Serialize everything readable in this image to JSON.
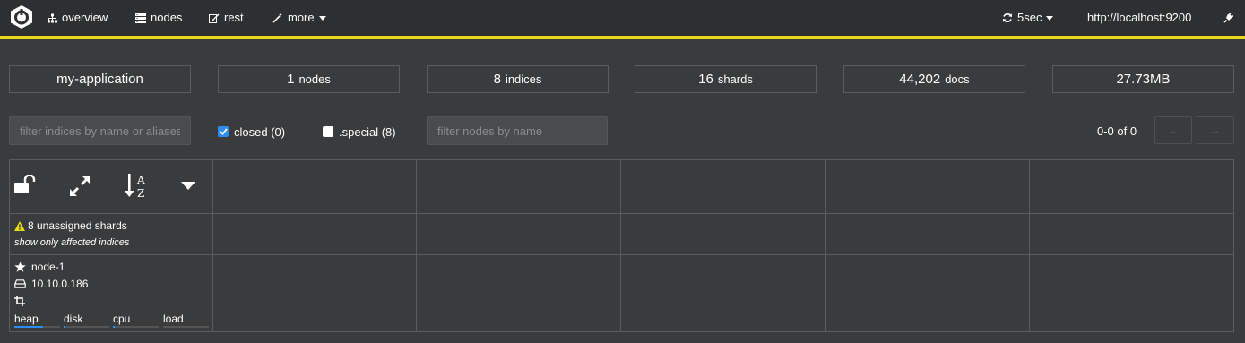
{
  "nav": {
    "items": [
      {
        "label": "overview",
        "icon": "sitemap-icon"
      },
      {
        "label": "nodes",
        "icon": "server-icon"
      },
      {
        "label": "rest",
        "icon": "edit-icon"
      },
      {
        "label": "more",
        "icon": "magic-wand-icon"
      }
    ],
    "refresh_label": "5sec",
    "host": "http://localhost:9200",
    "accent_color": "#e8d91a"
  },
  "stats": {
    "cluster_name": "my-application",
    "nodes_count": "1",
    "nodes_unit": "nodes",
    "indices_count": "8",
    "indices_unit": "indices",
    "shards_count": "16",
    "shards_unit": "shards",
    "docs_count": "44,202",
    "docs_unit": "docs",
    "size": "27.73MB"
  },
  "filters": {
    "indices_placeholder": "filter indices by name or aliases",
    "closed_label": "closed (0)",
    "closed_checked": true,
    "special_label": ".special (8)",
    "special_checked": false,
    "nodes_placeholder": "filter nodes by name",
    "pager_text": "0-0 of 0"
  },
  "grid": {
    "unassigned_text": "8 unassigned shards",
    "affected_link": "show only affected indices",
    "node": {
      "name": "node-1",
      "ip": "10.10.0.186",
      "metrics": [
        {
          "label": "heap",
          "value": 0.62
        },
        {
          "label": "disk",
          "value": 0.03
        },
        {
          "label": "cpu",
          "value": 0.03
        },
        {
          "label": "load",
          "value": 0.0
        }
      ]
    }
  }
}
